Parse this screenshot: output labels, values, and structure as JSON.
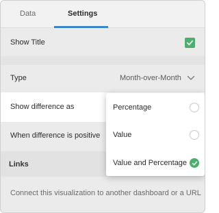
{
  "tabs": [
    {
      "label": "Data",
      "active": false
    },
    {
      "label": "Settings",
      "active": true
    }
  ],
  "settings": {
    "show_title": {
      "label": "Show Title",
      "checked": true
    },
    "type": {
      "label": "Type",
      "value": "Month-over-Month"
    },
    "show_difference_as": {
      "label": "Show difference as"
    },
    "when_positive": {
      "label": "When difference is positive"
    },
    "links": {
      "label": "Links"
    },
    "connect": {
      "label": "Connect this visualization to another dashboard or a URL"
    }
  },
  "dropdown": {
    "options": [
      {
        "label": "Percentage",
        "selected": false
      },
      {
        "label": "Value",
        "selected": false
      },
      {
        "label": "Value and Percentage",
        "selected": true
      }
    ]
  },
  "colors": {
    "accent": "#3a86c8",
    "check": "#4caf6e"
  },
  "icons": {
    "checkbox": "checkmark-icon",
    "type_dropdown": "chevron-down-icon",
    "selected_radio": "checkmark-icon"
  }
}
